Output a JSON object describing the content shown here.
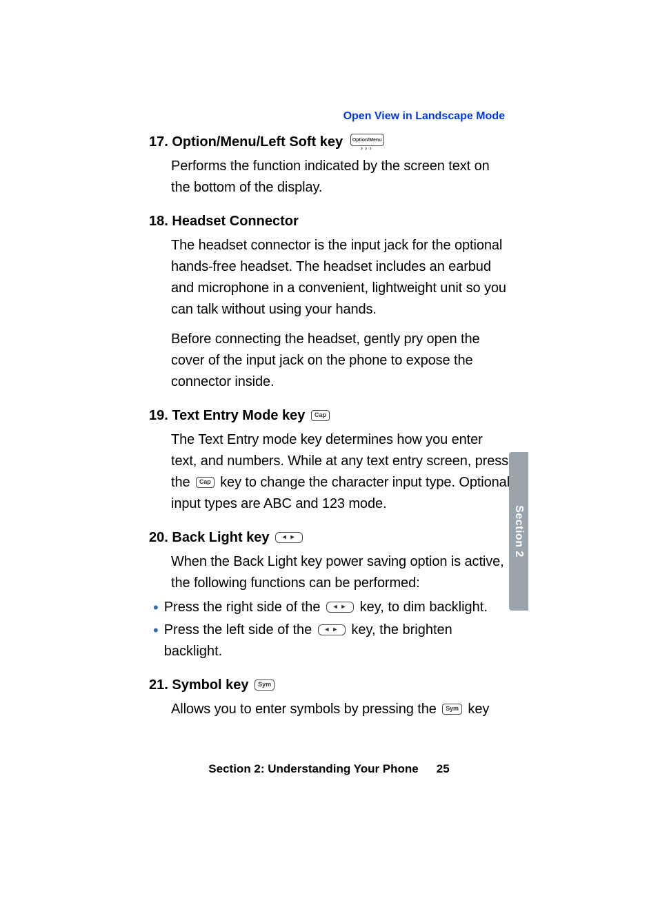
{
  "header_link": "Open View in Landscape Mode",
  "tab_label": "Section 2",
  "footer": {
    "title": "Section 2: Understanding Your Phone",
    "page": "25"
  },
  "keys": {
    "option_label": "Option/Menu",
    "cap_label": "Cap",
    "sym_label": "Sym",
    "backlight_glyph": "◂  ▸"
  },
  "items": [
    {
      "num": "17.",
      "title": "Option/Menu/Left Soft key",
      "key": "option",
      "paras": [
        "Performs the function indicated by the screen text on the bottom of the display."
      ]
    },
    {
      "num": "18.",
      "title": "Headset Connector",
      "paras": [
        "The headset connector is the input jack for the optional hands-free headset. The headset includes an earbud and microphone in a convenient, lightweight unit so you can talk without using your hands.",
        "Before connecting the headset, gently pry open the cover of the input jack on the phone to expose the connector inside."
      ]
    },
    {
      "num": "19.",
      "title": "Text Entry Mode key",
      "key": "cap",
      "paras_mixed": {
        "pre": "The Text Entry mode key determines how you enter text, and numbers. While at any text entry screen, press the ",
        "inline_key": "cap",
        "post": " key to change the character input type. Optional input types are ABC and 123 mode."
      }
    },
    {
      "num": "20.",
      "title": "Back Light key",
      "key": "backlight",
      "paras": [
        "When the Back Light key power saving option is active, the following functions can be performed:"
      ],
      "bullets": [
        {
          "pre": "Press the right side of the  ",
          "key": "backlight",
          "post": "  key, to dim backlight."
        },
        {
          "pre": "Press the left side of the  ",
          "key": "backlight",
          "post": "  key, the brighten backlight."
        }
      ]
    },
    {
      "num": "21.",
      "title": "Symbol key",
      "key": "sym",
      "paras_mixed": {
        "pre": "Allows you to enter symbols by pressing the  ",
        "inline_key": "sym",
        "post": "  key"
      }
    }
  ]
}
